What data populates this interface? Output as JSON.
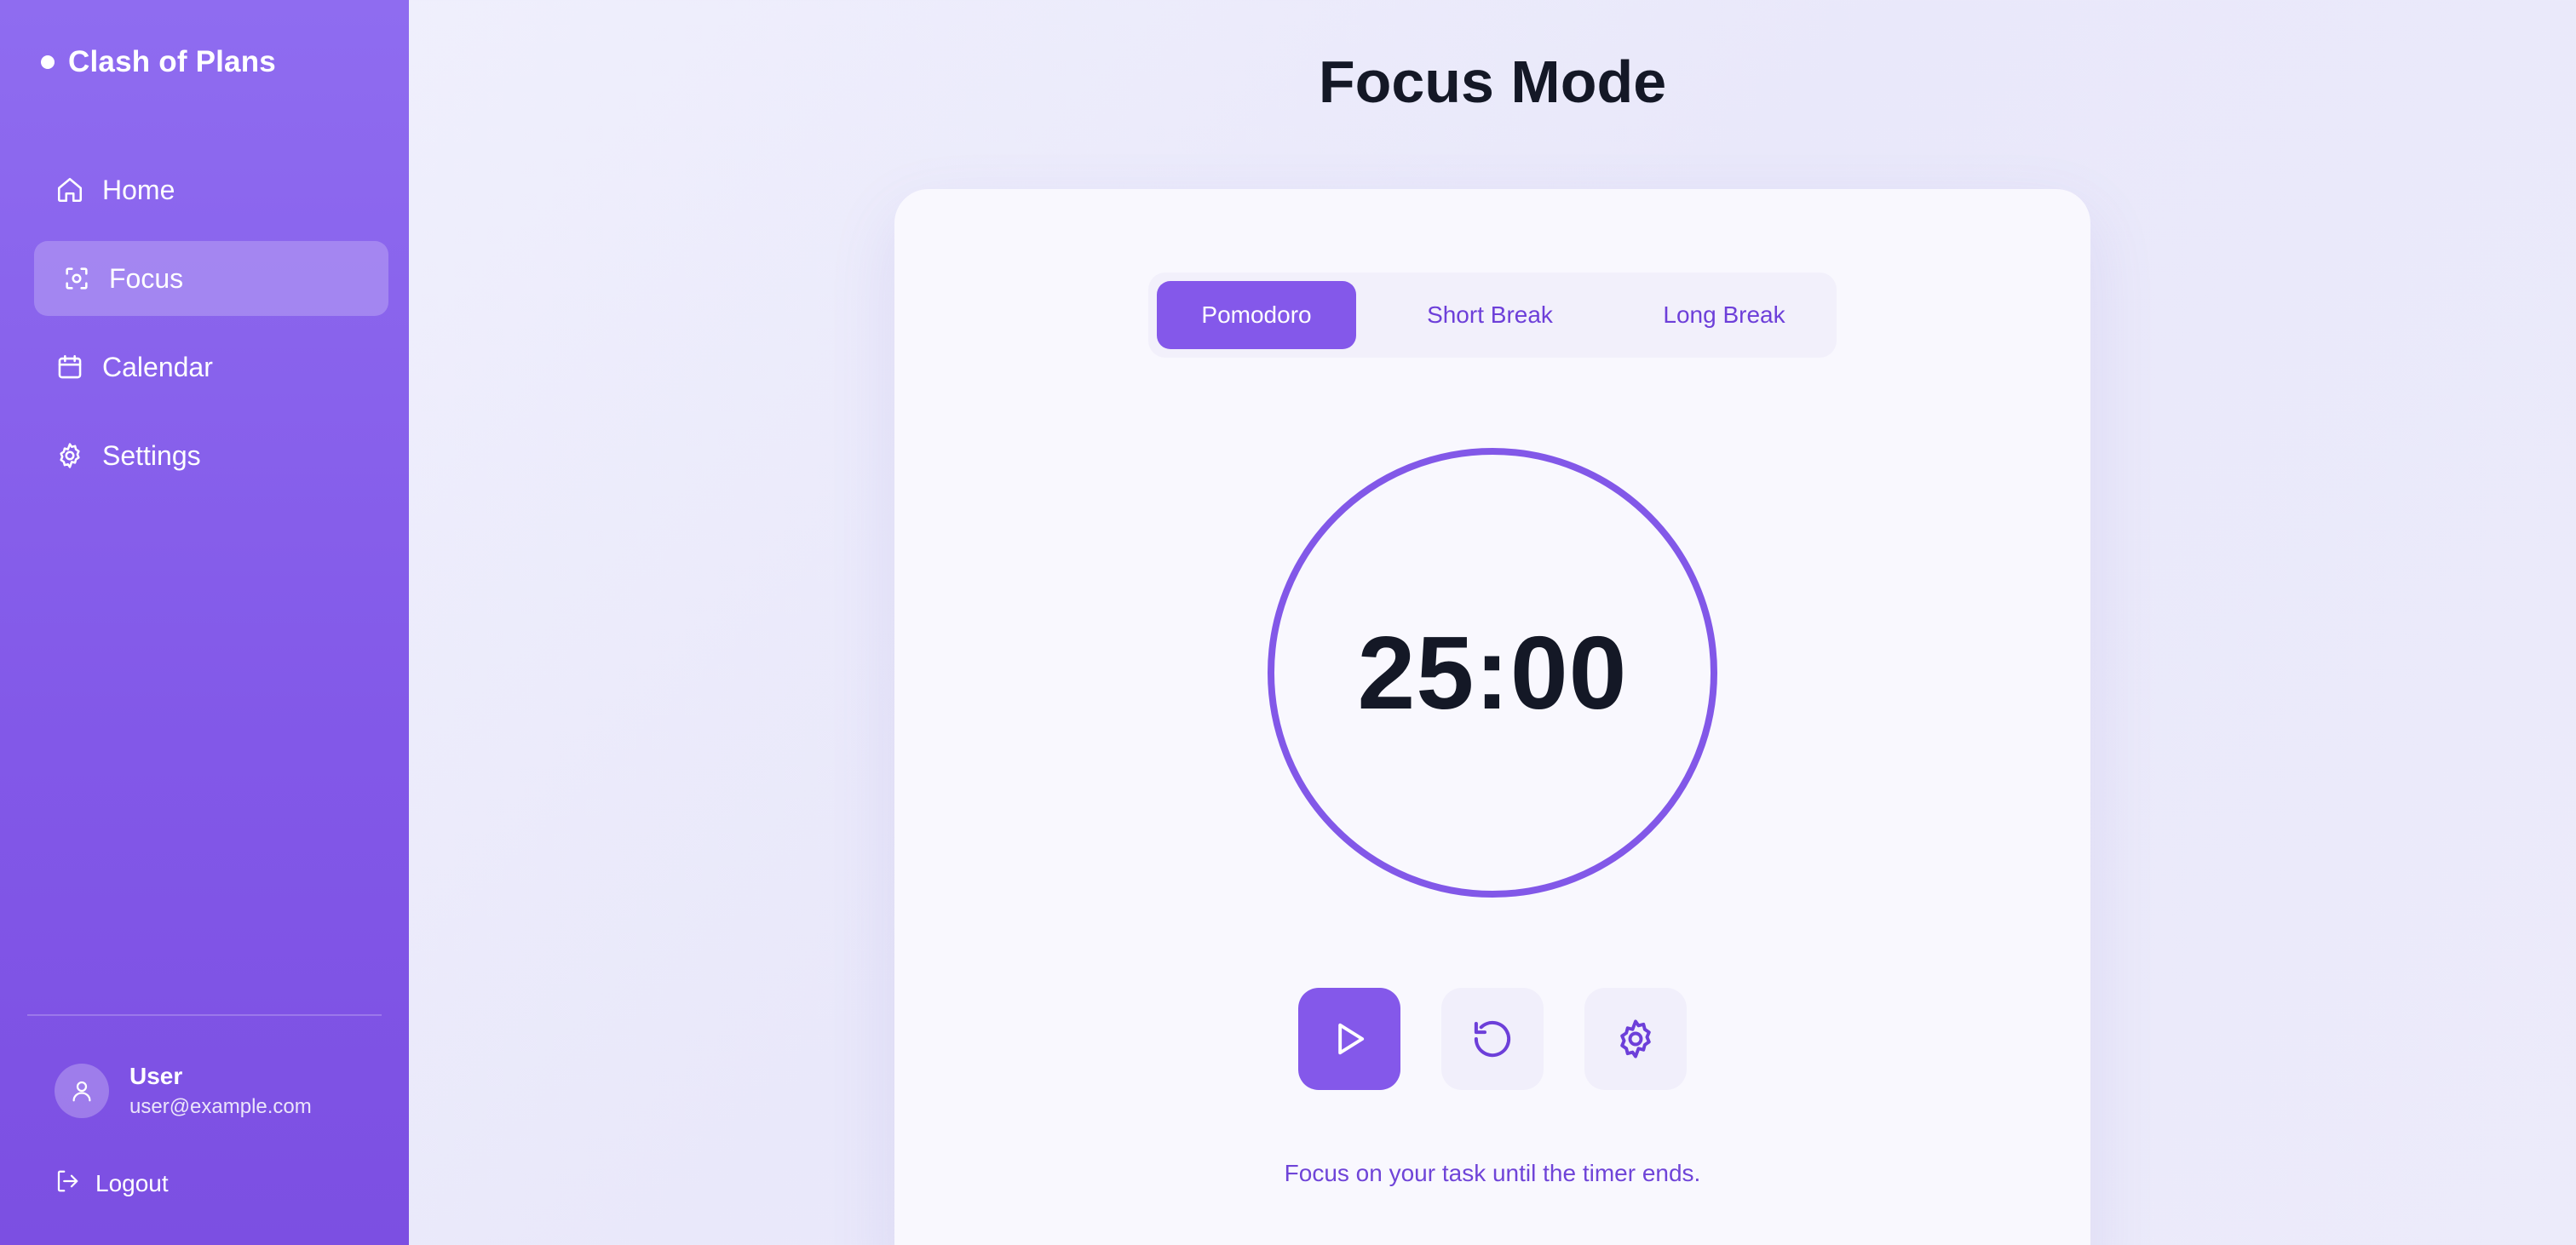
{
  "app": {
    "name": "Clash of Plans",
    "page_title": "Focus Mode"
  },
  "sidebar": {
    "items": [
      {
        "label": "Home",
        "icon": "home-icon",
        "active": false
      },
      {
        "label": "Focus",
        "icon": "focus-icon",
        "active": true
      },
      {
        "label": "Calendar",
        "icon": "calendar-icon",
        "active": false
      },
      {
        "label": "Settings",
        "icon": "gear-icon",
        "active": false
      }
    ],
    "user": {
      "name": "User",
      "email": "user@example.com"
    },
    "logout_label": "Logout"
  },
  "timer": {
    "tabs": [
      {
        "label": "Pomodoro",
        "active": true
      },
      {
        "label": "Short Break",
        "active": false
      },
      {
        "label": "Long Break",
        "active": false
      }
    ],
    "time": "25:00",
    "controls": [
      "play-icon",
      "reset-icon",
      "gear-icon"
    ],
    "hint": "Focus on your task until the timer ends."
  },
  "colors": {
    "accent": "#8458ea",
    "accent_text": "#6d3fd9",
    "title_text": "#141826",
    "card_bg": "#f9f8fe"
  }
}
